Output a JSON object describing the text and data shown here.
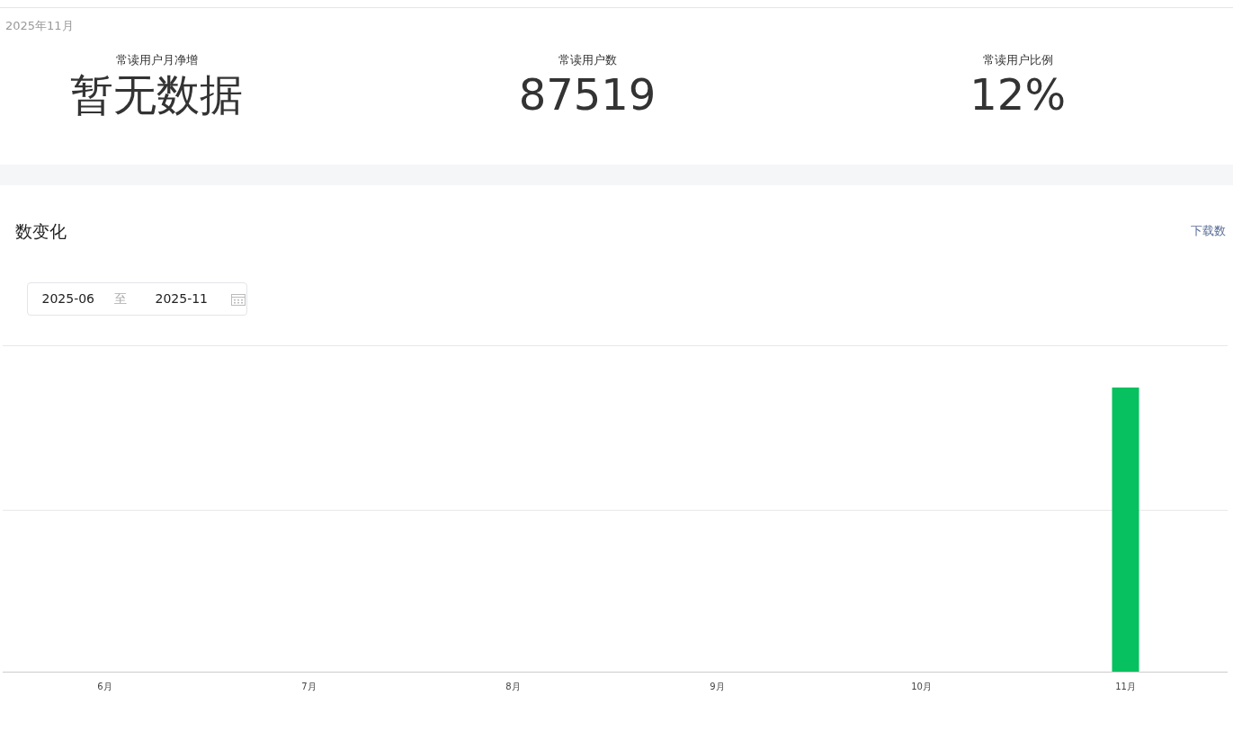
{
  "period": "2025年11月",
  "stats": [
    {
      "label": "常读用户月净增",
      "value": "暂无数据"
    },
    {
      "label": "常读用户数",
      "value": "87519"
    },
    {
      "label": "常读用户比例",
      "value": "12%"
    }
  ],
  "section": {
    "title": "数变化",
    "download_link": "下载数"
  },
  "date_range": {
    "start": "2025-06",
    "separator": "至",
    "end": "2025-11"
  },
  "months": [
    {
      "label": "6月",
      "has_bar": false
    },
    {
      "label": "7月",
      "has_bar": false
    },
    {
      "label": "8月",
      "has_bar": false
    },
    {
      "label": "9月",
      "has_bar": false
    },
    {
      "label": "10月",
      "has_bar": false
    },
    {
      "label": "11月",
      "has_bar": true
    }
  ]
}
